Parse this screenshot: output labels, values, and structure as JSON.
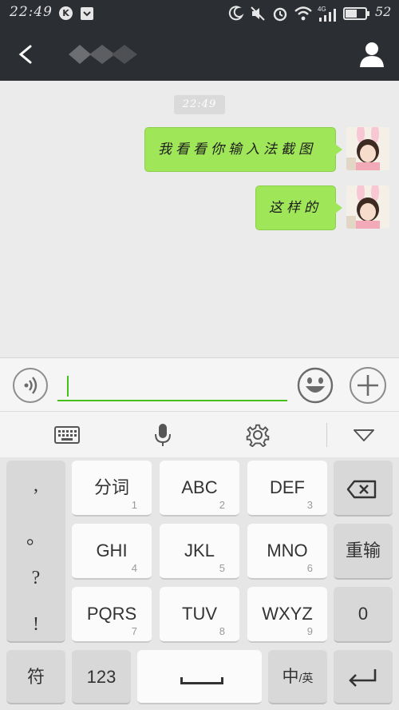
{
  "status_bar": {
    "time": "22:49",
    "battery": "52"
  },
  "chat": {
    "timestamp": "22:49",
    "messages": [
      {
        "text": "我看看你输入法截图"
      },
      {
        "text": "这样的"
      }
    ]
  },
  "input": {
    "value": ""
  },
  "keyboard": {
    "symbols": [
      ",",
      "。",
      "?",
      "!"
    ],
    "keys": {
      "fenci": {
        "label": "分词",
        "num": "1"
      },
      "abc": {
        "label": "ABC",
        "num": "2"
      },
      "def": {
        "label": "DEF",
        "num": "3"
      },
      "ghi": {
        "label": "GHI",
        "num": "4"
      },
      "jkl": {
        "label": "JKL",
        "num": "5"
      },
      "mno": {
        "label": "MNO",
        "num": "6"
      },
      "pqrs": {
        "label": "PQRS",
        "num": "7"
      },
      "tuv": {
        "label": "TUV",
        "num": "8"
      },
      "wxyz": {
        "label": "WXYZ",
        "num": "9"
      },
      "retype": "重输",
      "zero": "0",
      "symbol": "符",
      "numbers": "123",
      "lang_main": "中",
      "lang_alt": "/英"
    }
  },
  "colors": {
    "header_bg": "#2b2e33",
    "bubble_green": "#9fe658",
    "accent_green": "#45c01a"
  },
  "icons": [
    "back-arrow-icon",
    "person-icon",
    "voice-icon",
    "emoji-icon",
    "plus-icon",
    "keyboard-icon",
    "microphone-icon",
    "gear-icon",
    "collapse-triangle-icon",
    "backspace-icon",
    "enter-icon"
  ]
}
